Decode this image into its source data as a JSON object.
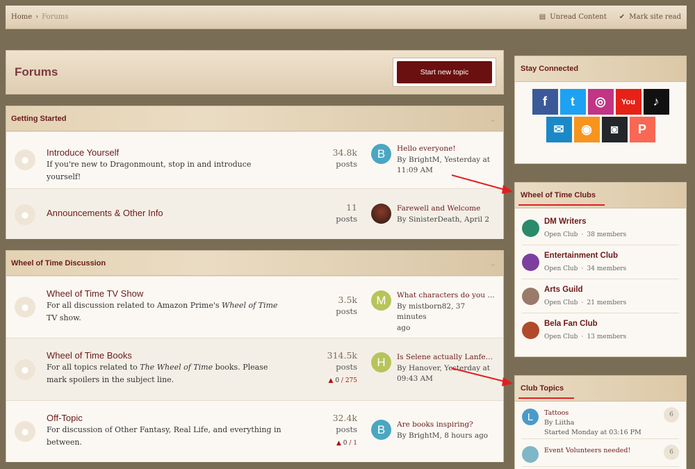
{
  "breadcrumb": {
    "home": "Home",
    "separator": "›",
    "current": "Forums"
  },
  "topbar": {
    "unread": "Unread Content",
    "mark_read": "Mark site read"
  },
  "page": {
    "title": "Forums",
    "start_topic": "Start new topic"
  },
  "sections": [
    {
      "title": "Getting Started"
    },
    {
      "title": "Wheel of Time Discussion"
    }
  ],
  "nodes": {
    "intro": {
      "title": "Introduce Yourself",
      "desc": "If you're new to Dragonmount, stop in and introduce yourself!",
      "count": "34.8k",
      "unit": "posts",
      "avatar": "B",
      "avatar_color": "#4aa6c2",
      "last_title": "Hello everyone!",
      "last_by": "By BrightM, Yesterday at",
      "last_time": "11:09 AM"
    },
    "announce": {
      "title": "Announcements & Other Info",
      "count": "11",
      "unit": "posts",
      "last_title": "Farewell and Welcome",
      "last_by": "By SinisterDeath, April 2"
    },
    "tv": {
      "title": "Wheel of Time TV Show",
      "desc_pre": "For all discussion related to Amazon Prime's ",
      "desc_em": "Wheel of Time",
      "desc_post": " TV show.",
      "count": "3.5k",
      "unit": "posts",
      "avatar": "M",
      "avatar_color": "#b7c45a",
      "last_title": "What characters do you thi...",
      "last_by": "By mistborn82, 37 minutes",
      "last_time": "ago"
    },
    "books": {
      "title": "Wheel of Time Books",
      "desc_pre": "For all topics related to ",
      "desc_em": "The Wheel of Time",
      "desc_post": " books. Please mark spoilers in the subject line.",
      "count": "314.5k",
      "unit": "posts",
      "warn_zero": "0",
      "warn_total": "/ 275",
      "avatar": "H",
      "avatar_color": "#b7c45a",
      "last_title": "Is Selene actually Lanfear?",
      "last_by": "By Hanover, Yesterday at",
      "last_time": "09:43 AM"
    },
    "offtopic": {
      "title": "Off-Topic",
      "desc": "For discussion of Other Fantasy, Real Life, and everything in between.",
      "count": "32.4k",
      "unit": "posts",
      "warn_zero": "0",
      "warn_total": "/ 1",
      "avatar": "B",
      "avatar_color": "#4aa6c2",
      "last_title": "Are books inspiring?",
      "last_by": "By BrightM, 8 hours ago"
    }
  },
  "sidebar": {
    "stay_connected": "Stay Connected",
    "social": [
      {
        "name": "facebook-icon",
        "glyph": "f",
        "color": "#3b5998"
      },
      {
        "name": "twitter-icon",
        "glyph": "t",
        "color": "#1da1f2"
      },
      {
        "name": "instagram-icon",
        "glyph": "◎",
        "color": "#c13584"
      },
      {
        "name": "youtube-icon",
        "glyph": "You",
        "color": "#e62117"
      },
      {
        "name": "tiktok-icon",
        "glyph": "♪",
        "color": "#111111"
      },
      {
        "name": "email-icon",
        "glyph": "✉",
        "color": "#1b88c8"
      },
      {
        "name": "rss-icon",
        "glyph": "◉",
        "color": "#f7941d"
      },
      {
        "name": "discord-icon",
        "glyph": "◙",
        "color": "#23272a"
      },
      {
        "name": "patreon-icon",
        "glyph": "P",
        "color": "#f96854"
      }
    ],
    "clubs_title": "Wheel of Time Clubs",
    "clubs": [
      {
        "name": "DM Writers",
        "type": "Open Club",
        "members": "38 members",
        "color": "#2a8a6a"
      },
      {
        "name": "Entertainment Club",
        "type": "Open Club",
        "members": "34 members",
        "color": "#7c3fa0"
      },
      {
        "name": "Arts Guild",
        "type": "Open Club",
        "members": "21 members",
        "color": "#9a7a6a"
      },
      {
        "name": "Bela Fan Club",
        "type": "Open Club",
        "members": "13 members",
        "color": "#b04a2a"
      }
    ],
    "member_sep": "·",
    "topics_title": "Club Topics",
    "topics": [
      {
        "title": "Tattoos",
        "by": "By Liitha",
        "started": "Started Monday at 03:16 PM",
        "count": "6",
        "avatar": "L",
        "avatar_color": "#4a9ac8"
      },
      {
        "title": "Event Volunteers needed!",
        "count": "6",
        "avatar": "",
        "avatar_color": "#7fb6c8"
      }
    ]
  }
}
